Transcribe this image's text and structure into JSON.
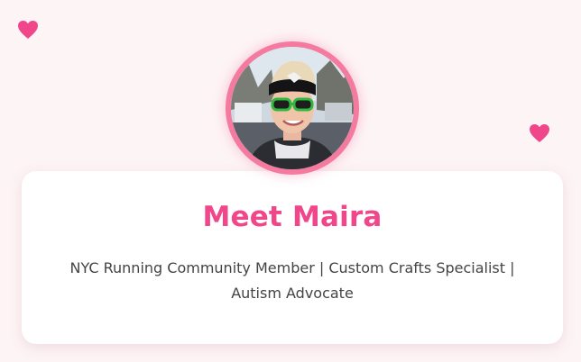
{
  "decorations": {
    "heart_icon": "heart-icon",
    "heart_color": "#f0468a"
  },
  "profile": {
    "avatar_icon": "profile-photo",
    "ring_color": "#f47aa0",
    "title": "Meet Maira",
    "subtitle": "NYC Running Community Member | Custom Crafts Specialist | Autism Advocate",
    "title_color": "#f0468a"
  }
}
